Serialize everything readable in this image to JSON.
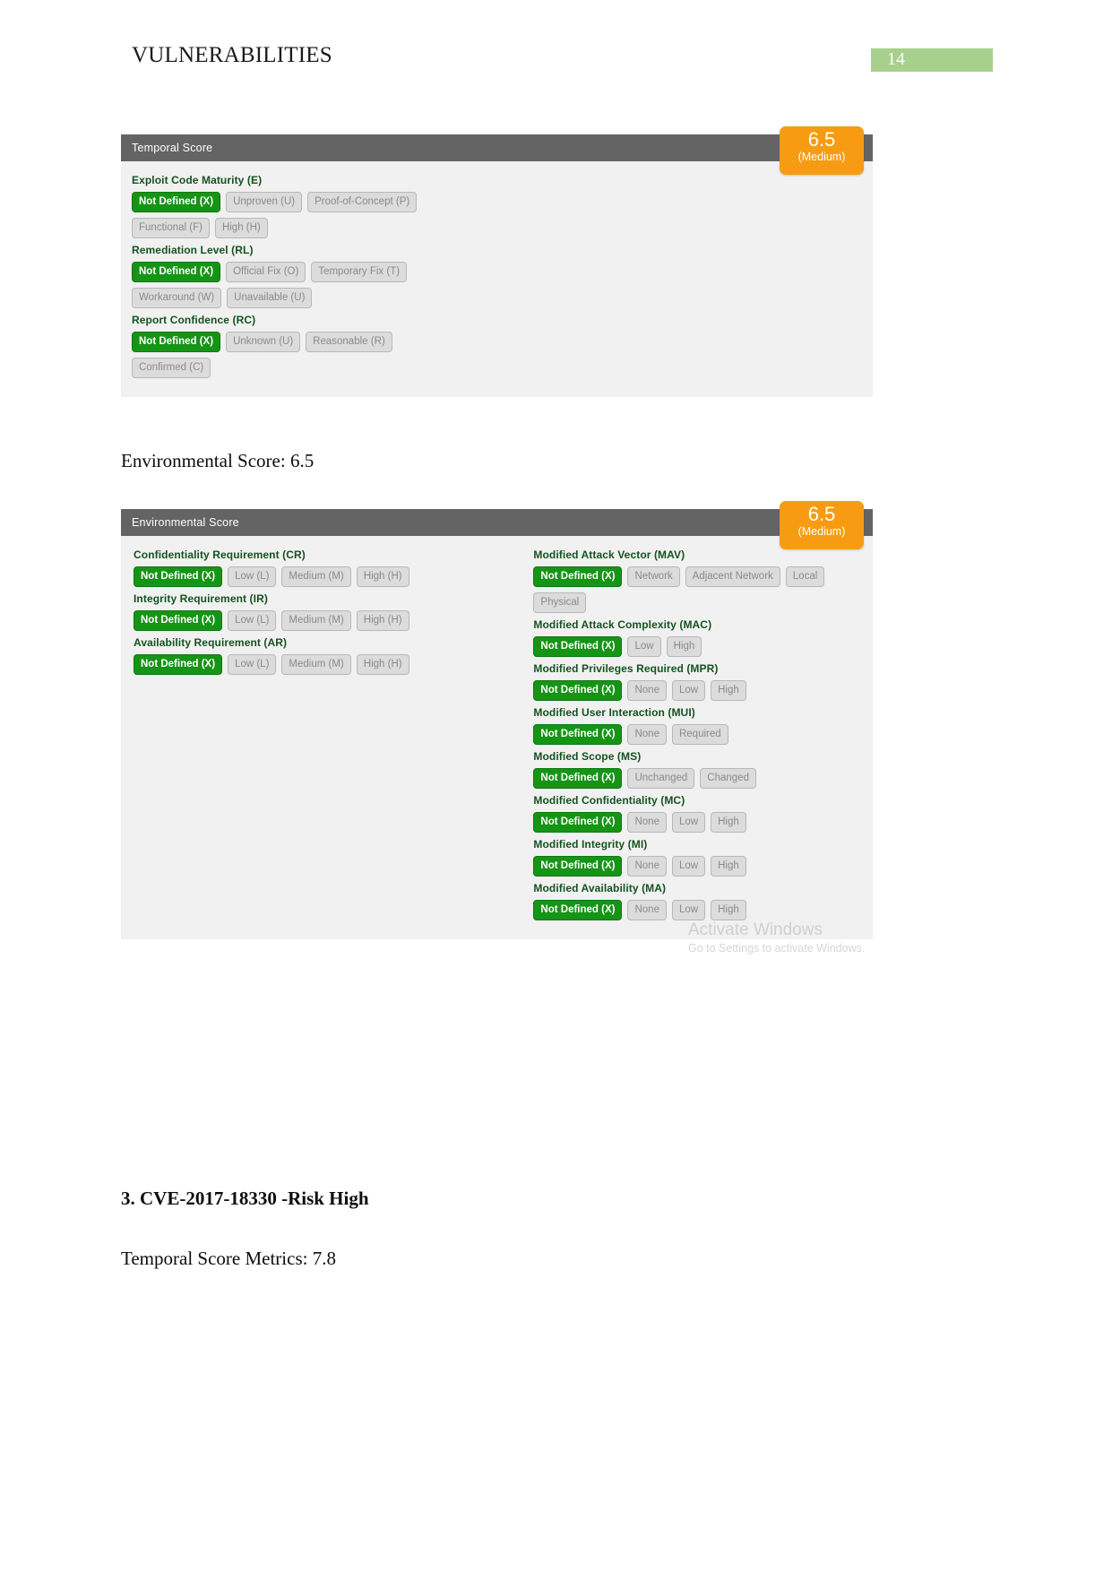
{
  "header": {
    "title": "VULNERABILITIES",
    "page_number": "14"
  },
  "temporal_panel": {
    "title": "Temporal Score",
    "score": "6.5",
    "rating": "(Medium)",
    "groups": [
      {
        "label": "Exploit Code Maturity (E)",
        "options": [
          {
            "text": "Not Defined (X)",
            "selected": true
          },
          {
            "text": "Unproven (U)",
            "selected": false
          },
          {
            "text": "Proof-of-Concept (P)",
            "selected": false
          },
          {
            "text": "Functional (F)",
            "selected": false
          },
          {
            "text": "High (H)",
            "selected": false
          }
        ]
      },
      {
        "label": "Remediation Level (RL)",
        "options": [
          {
            "text": "Not Defined (X)",
            "selected": true
          },
          {
            "text": "Official Fix (O)",
            "selected": false
          },
          {
            "text": "Temporary Fix (T)",
            "selected": false
          },
          {
            "text": "Workaround (W)",
            "selected": false
          },
          {
            "text": "Unavailable (U)",
            "selected": false
          }
        ]
      },
      {
        "label": "Report Confidence (RC)",
        "options": [
          {
            "text": "Not Defined (X)",
            "selected": true
          },
          {
            "text": "Unknown (U)",
            "selected": false
          },
          {
            "text": "Reasonable (R)",
            "selected": false
          },
          {
            "text": "Confirmed (C)",
            "selected": false
          }
        ]
      }
    ]
  },
  "environmental_heading": "Environmental Score: 6.5",
  "environmental_panel": {
    "title": "Environmental Score",
    "score": "6.5",
    "rating": "(Medium)",
    "left_groups": [
      {
        "label": "Confidentiality Requirement (CR)",
        "options": [
          {
            "text": "Not Defined (X)",
            "selected": true
          },
          {
            "text": "Low (L)",
            "selected": false
          },
          {
            "text": "Medium (M)",
            "selected": false
          },
          {
            "text": "High (H)",
            "selected": false
          }
        ]
      },
      {
        "label": "Integrity Requirement (IR)",
        "options": [
          {
            "text": "Not Defined (X)",
            "selected": true
          },
          {
            "text": "Low (L)",
            "selected": false
          },
          {
            "text": "Medium (M)",
            "selected": false
          },
          {
            "text": "High (H)",
            "selected": false
          }
        ]
      },
      {
        "label": "Availability Requirement (AR)",
        "options": [
          {
            "text": "Not Defined (X)",
            "selected": true
          },
          {
            "text": "Low (L)",
            "selected": false
          },
          {
            "text": "Medium (M)",
            "selected": false
          },
          {
            "text": "High (H)",
            "selected": false
          }
        ]
      }
    ],
    "right_groups": [
      {
        "label": "Modified Attack Vector (MAV)",
        "options": [
          {
            "text": "Not Defined (X)",
            "selected": true
          },
          {
            "text": "Network",
            "selected": false
          },
          {
            "text": "Adjacent Network",
            "selected": false
          },
          {
            "text": "Local",
            "selected": false
          },
          {
            "text": "Physical",
            "selected": false
          }
        ]
      },
      {
        "label": "Modified Attack Complexity (MAC)",
        "options": [
          {
            "text": "Not Defined (X)",
            "selected": true
          },
          {
            "text": "Low",
            "selected": false
          },
          {
            "text": "High",
            "selected": false
          }
        ]
      },
      {
        "label": "Modified Privileges Required (MPR)",
        "options": [
          {
            "text": "Not Defined (X)",
            "selected": true
          },
          {
            "text": "None",
            "selected": false
          },
          {
            "text": "Low",
            "selected": false
          },
          {
            "text": "High",
            "selected": false
          }
        ]
      },
      {
        "label": "Modified User Interaction (MUI)",
        "options": [
          {
            "text": "Not Defined (X)",
            "selected": true
          },
          {
            "text": "None",
            "selected": false
          },
          {
            "text": "Required",
            "selected": false
          }
        ]
      },
      {
        "label": "Modified Scope (MS)",
        "options": [
          {
            "text": "Not Defined (X)",
            "selected": true
          },
          {
            "text": "Unchanged",
            "selected": false
          },
          {
            "text": "Changed",
            "selected": false
          }
        ]
      },
      {
        "label": "Modified Confidentiality (MC)",
        "options": [
          {
            "text": "Not Defined (X)",
            "selected": true
          },
          {
            "text": "None",
            "selected": false
          },
          {
            "text": "Low",
            "selected": false
          },
          {
            "text": "High",
            "selected": false
          }
        ]
      },
      {
        "label": "Modified Integrity (MI)",
        "options": [
          {
            "text": "Not Defined (X)",
            "selected": true
          },
          {
            "text": "None",
            "selected": false
          },
          {
            "text": "Low",
            "selected": false
          },
          {
            "text": "High",
            "selected": false
          }
        ]
      },
      {
        "label": "Modified Availability (MA)",
        "options": [
          {
            "text": "Not Defined (X)",
            "selected": true
          },
          {
            "text": "None",
            "selected": false
          },
          {
            "text": "Low",
            "selected": false
          },
          {
            "text": "High",
            "selected": false
          }
        ]
      }
    ]
  },
  "watermark": {
    "line1": "Activate Windows",
    "line2": "Go to Settings to activate Windows."
  },
  "footer_section": {
    "cve_heading": "3. CVE-2017-18330 -Risk High",
    "temporal_metrics": "Temporal Score Metrics: 7.8"
  },
  "colors": {
    "panel_header": "#646464",
    "panel_body": "#f1f1f1",
    "selected_green": "#169416",
    "badge_orange": "#f79c12",
    "page_badge_green": "#a8d08d",
    "label_green": "#14521f"
  }
}
